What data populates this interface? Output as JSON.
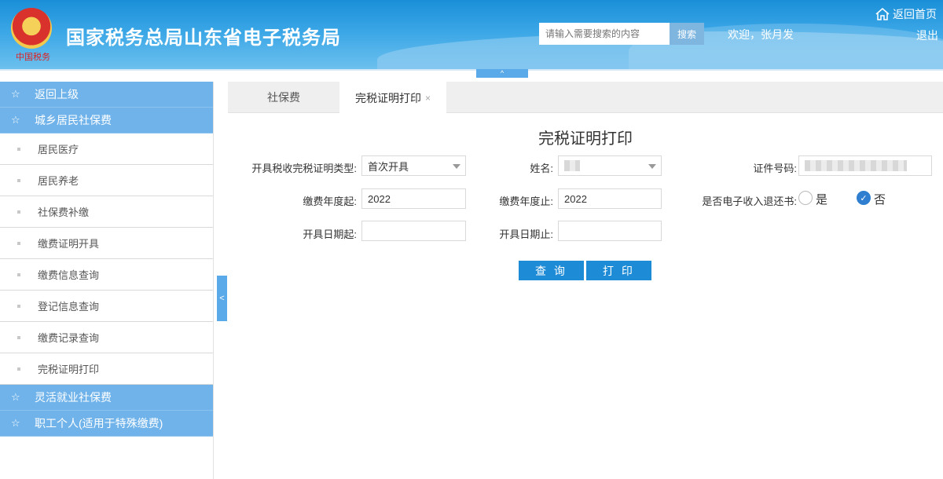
{
  "header": {
    "site_title": "国家税务总局山东省电子税务局",
    "emblem_caption": "中国税务",
    "search_placeholder": "请输入需要搜索的内容",
    "search_button": "搜索",
    "welcome": "欢迎，张月发",
    "home_link": "返回首页",
    "logout": "退出",
    "collapse_arrow": "^"
  },
  "sidebar": {
    "groups_top": [
      {
        "label": "返回上级",
        "icon": "star-icon"
      },
      {
        "label": "城乡居民社保费",
        "icon": "star-icon"
      }
    ],
    "items": [
      "居民医疗",
      "居民养老",
      "社保费补缴",
      "缴费证明开具",
      "缴费信息查询",
      "登记信息查询",
      "缴费记录查询",
      "完税证明打印"
    ],
    "groups_bottom": [
      {
        "label": "灵活就业社保费",
        "icon": "star-icon"
      },
      {
        "label": "职工个人(适用于特殊缴费)",
        "icon": "star-icon"
      }
    ],
    "toggle": "<"
  },
  "tabs": [
    {
      "label": "社保费",
      "active": false
    },
    {
      "label": "完税证明打印",
      "active": true,
      "close": "×"
    }
  ],
  "form": {
    "title": "完税证明打印",
    "cert_type_label": "开具税收完税证明类型:",
    "cert_type_value": "首次开具",
    "name_label": "姓名:",
    "id_label": "证件号码:",
    "year_start_label": "缴费年度起:",
    "year_start_value": "2022",
    "year_end_label": "缴费年度止:",
    "year_end_value": "2022",
    "refund_label": "是否电子收入退还书:",
    "radio_yes": "是",
    "radio_no": "否",
    "radio_selected": "否",
    "date_start_label": "开具日期起:",
    "date_end_label": "开具日期止:",
    "query_button": "查 询",
    "print_button": "打 印"
  },
  "colors": {
    "header_blue": "#1a8fd8",
    "sidebar_head": "#6fb3ea",
    "button_blue": "#1e8bd6",
    "radio_checked": "#2f7ecf"
  }
}
